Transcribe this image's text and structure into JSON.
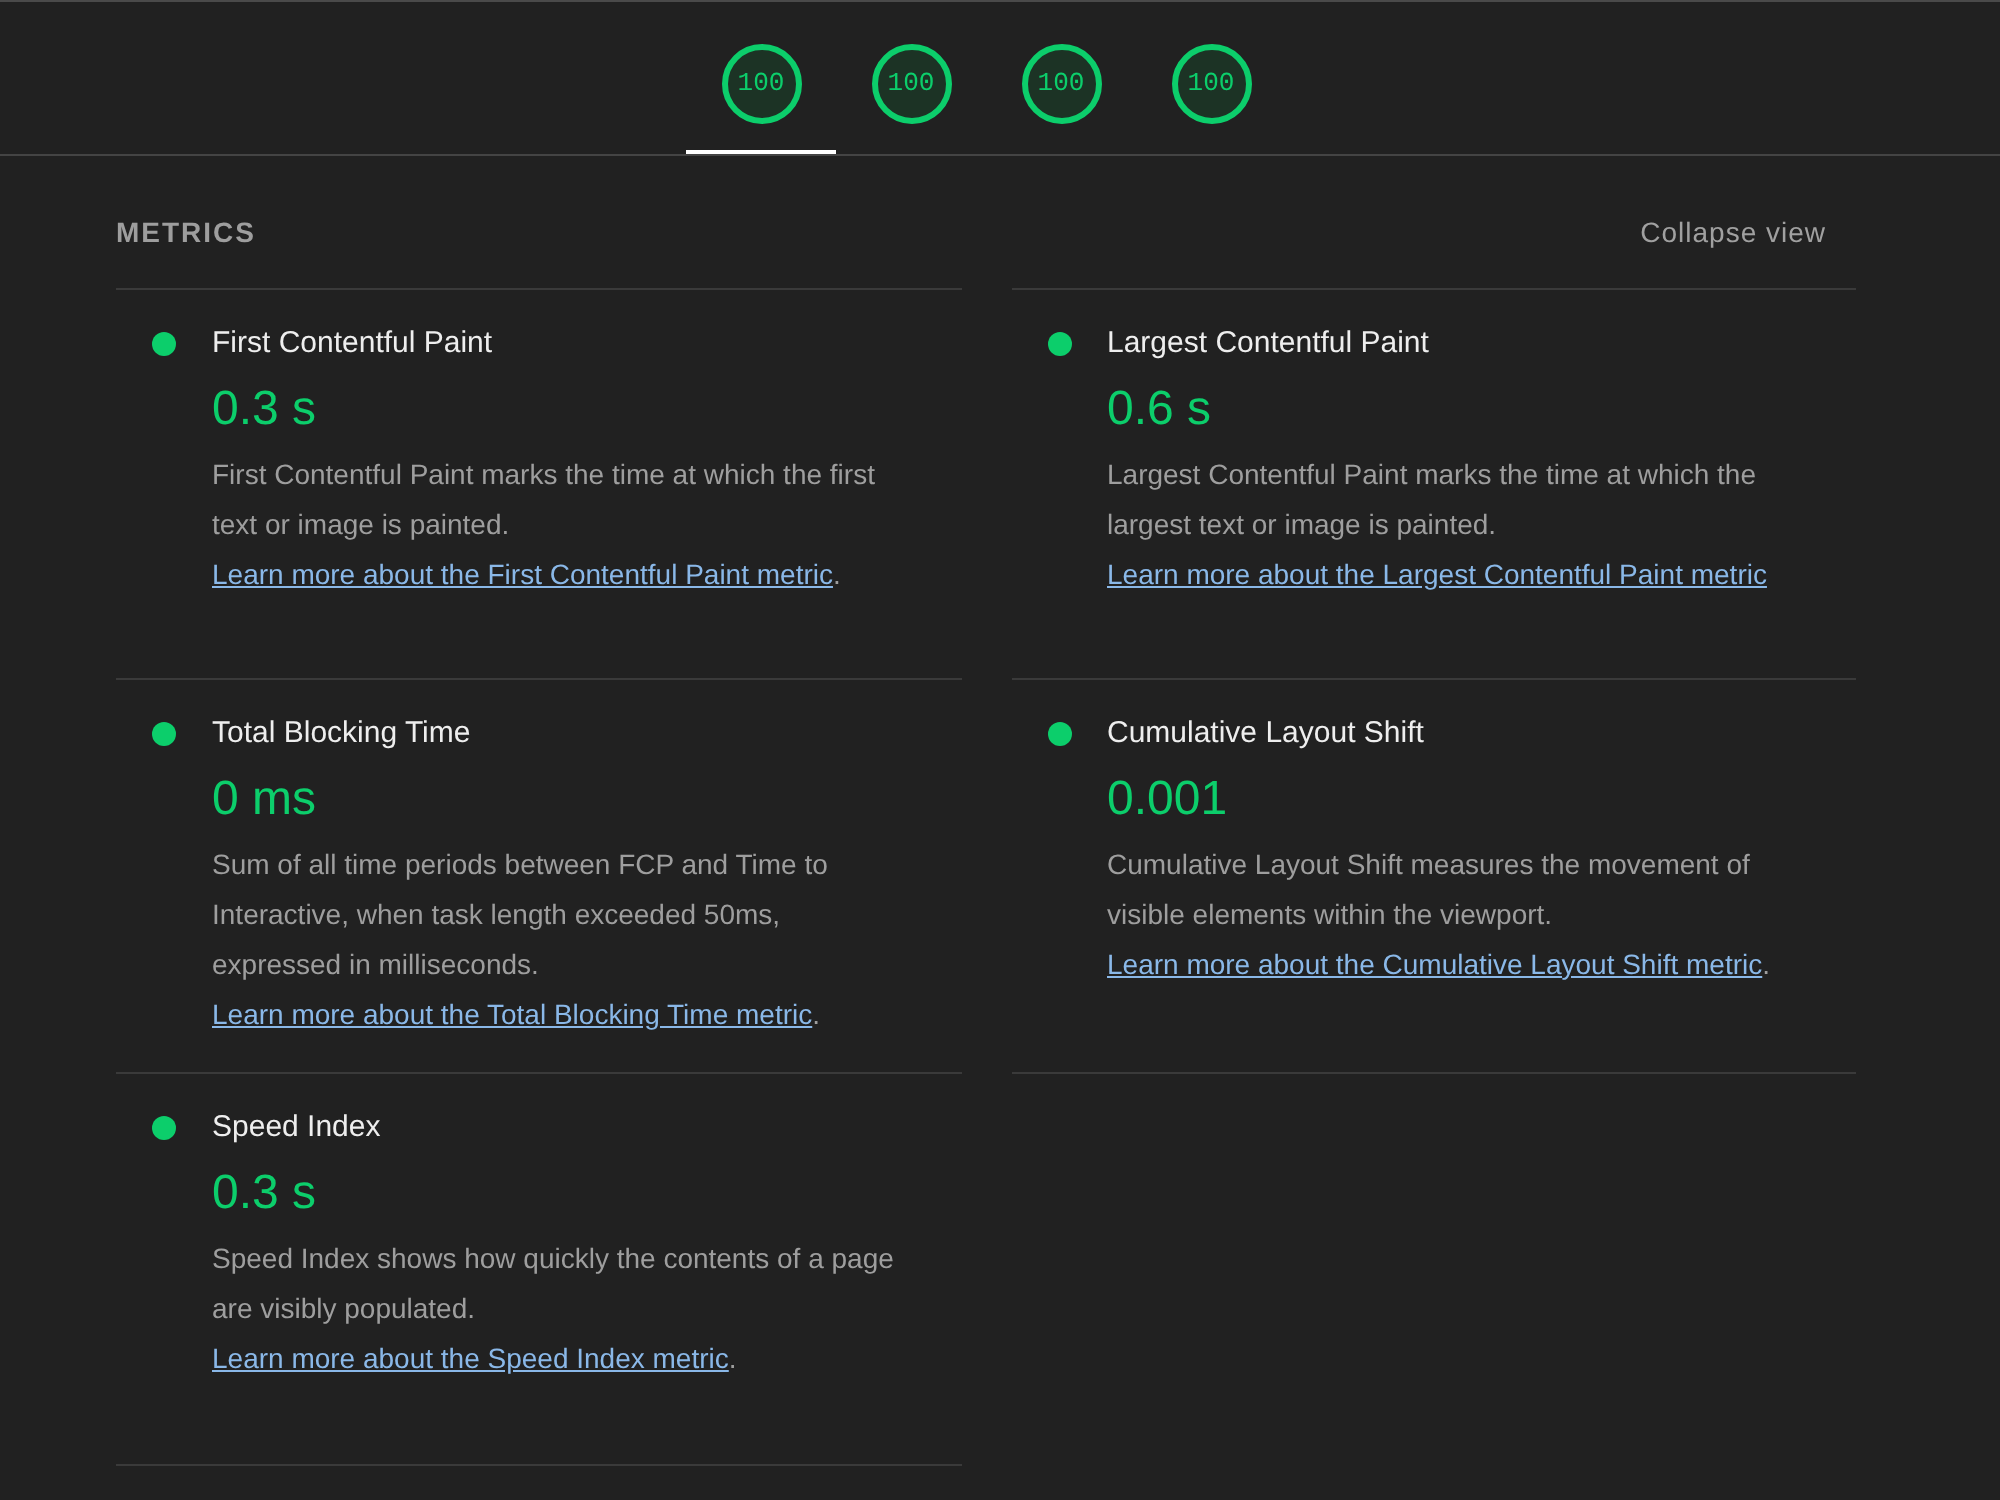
{
  "score_tabs": [
    {
      "score": "100",
      "selected": true
    },
    {
      "score": "100",
      "selected": false
    },
    {
      "score": "100",
      "selected": false
    },
    {
      "score": "100",
      "selected": false
    }
  ],
  "metrics_section": {
    "heading": "METRICS",
    "toggle": "Collapse view"
  },
  "metrics": [
    {
      "title": "First Contentful Paint",
      "value": "0.3 s",
      "color": "#0cce6b",
      "description": "First Contentful Paint marks the time at which the first text or image is painted.",
      "link": "Learn more about the First Contentful Paint metric",
      "after_link": "."
    },
    {
      "title": "Largest Contentful Paint",
      "value": "0.6 s",
      "color": "#0cce6b",
      "description": "Largest Contentful Paint marks the time at which the largest text or image is painted.",
      "link": "Learn more about the Largest Contentful Paint metric"
    },
    {
      "title": "Total Blocking Time",
      "value": "0 ms",
      "color": "#0cce6b",
      "description": "Sum of all time periods between FCP and Time to Interactive, when task length exceeded 50ms, expressed in milliseconds.",
      "link": "Learn more about the Total Blocking Time metric",
      "after_link": "."
    },
    {
      "title": "Cumulative Layout Shift",
      "value": "0.001",
      "color": "#0cce6b",
      "description": "Cumulative Layout Shift measures the movement of visible elements within the viewport.",
      "link": "Learn more about the Cumulative Layout Shift metric",
      "after_link": "."
    },
    {
      "title": "Speed Index",
      "value": "0.3 s",
      "color": "#0cce6b",
      "description": "Speed Index shows how quickly the contents of a page are visibly populated.",
      "link": "Learn more about the Speed Index metric",
      "after_link": "."
    }
  ]
}
